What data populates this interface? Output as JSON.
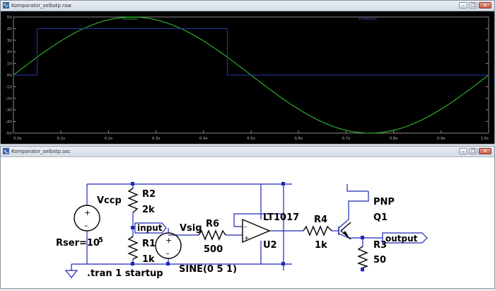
{
  "waveform_window": {
    "title": "Komparator_selbstp.raw",
    "buttons": {
      "minimize": "–",
      "restore": "❐",
      "close": "✕"
    }
  },
  "schematic_window": {
    "title": "Komparator_selbstp.asc",
    "buttons": {
      "minimize": "–",
      "restore": "❐",
      "close": "✕"
    }
  },
  "chart_data": {
    "type": "line",
    "series": [
      {
        "name": "V(n005)",
        "color": "#33cc33",
        "x": [
          0,
          0.05,
          0.1,
          0.15,
          0.2,
          0.25,
          0.3,
          0.35,
          0.4,
          0.45,
          0.5,
          0.55,
          0.6,
          0.65,
          0.7,
          0.75,
          0.8,
          0.85,
          0.9,
          0.95,
          1.0
        ],
        "y": [
          0,
          1.55,
          2.94,
          4.05,
          4.76,
          5.0,
          4.76,
          4.05,
          2.94,
          1.55,
          0,
          -1.55,
          -2.94,
          -4.05,
          -4.76,
          -5.0,
          -4.76,
          -4.05,
          -2.94,
          -1.55,
          0
        ]
      },
      {
        "name": "V(output)",
        "color": "#2a3aa8",
        "x": [
          0,
          0.05,
          0.05,
          0.45,
          0.45,
          1.0
        ],
        "y": [
          0,
          0,
          4,
          4,
          0,
          0
        ]
      }
    ],
    "xlim": [
      0,
      1.0
    ],
    "ylim": [
      -5,
      5
    ],
    "xticks": [
      "0.0s",
      "0.1s",
      "0.2s",
      "0.3s",
      "0.4s",
      "0.5s",
      "0.6s",
      "0.7s",
      "0.8s",
      "0.9s",
      "1.0s"
    ],
    "yticks": [
      "5V",
      "4V",
      "3V",
      "2V",
      "1V",
      "0V",
      "-1V",
      "-2V",
      "-3V",
      "-4V",
      "-5V"
    ],
    "grid": false,
    "legend": "top"
  },
  "schematic": {
    "labels": {
      "vccp": "Vccp",
      "rser": "Rser=10",
      "rser_exp": "5",
      "r2": "R2",
      "r2_val": "2k",
      "r1": "R1",
      "r1_val": "1k",
      "input": "input",
      "vsig": "Vsig",
      "sine": "SINE(0 5 1)",
      "r6": "R6",
      "r6_val": "500",
      "lt1017": "LT1017",
      "u2": "U2",
      "r4": "R4",
      "r4_val": "1k",
      "pnp": "PNP",
      "q1": "Q1",
      "r3": "R3",
      "r3_val": "50",
      "output": "output",
      "tran": ".tran 1 startup",
      "opamp_minus": "–",
      "opamp_plus": "+",
      "vsrc_plus": "+",
      "vsrc_minus": "–",
      "vsig_plus": "+",
      "vsig_minus": "–"
    }
  }
}
